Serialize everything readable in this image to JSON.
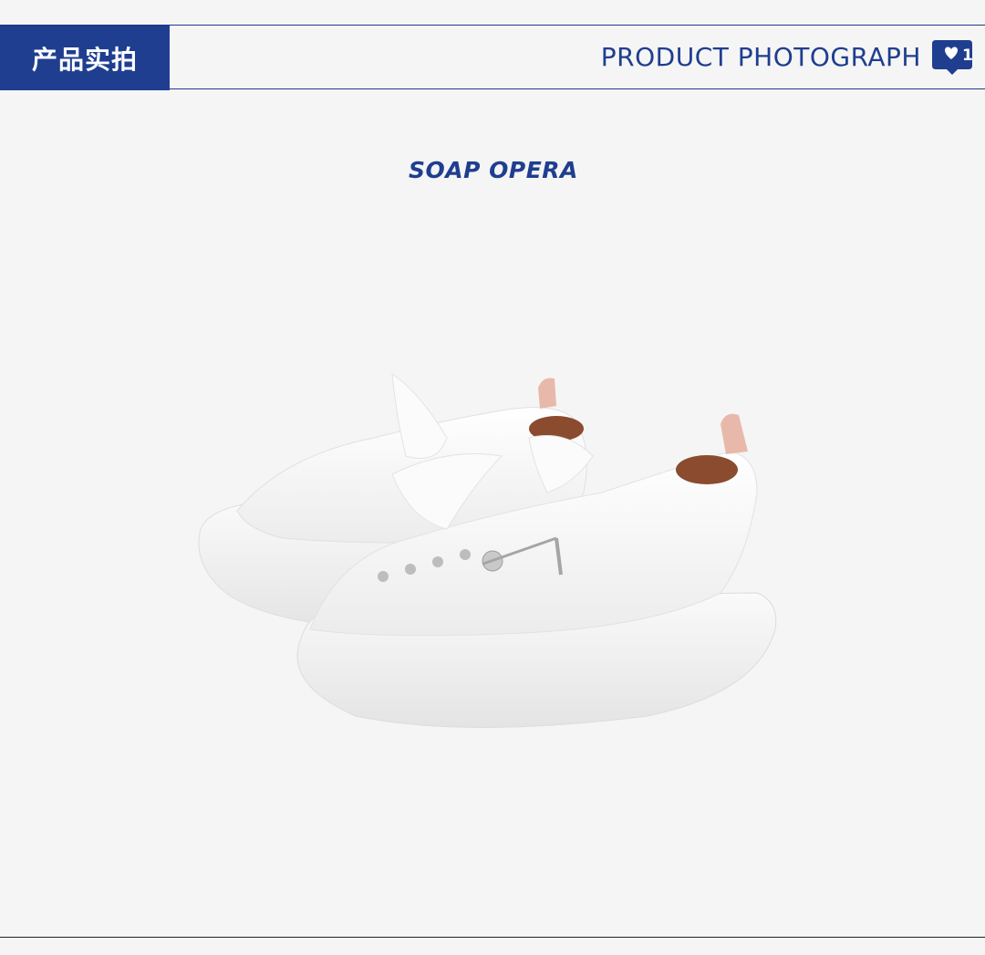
{
  "header": {
    "cn_title": "产品实拍",
    "en_title": "PRODUCT PHOTOGRAPH",
    "like_count": "1"
  },
  "brand": {
    "name": "SOAP OPERA"
  },
  "colors": {
    "brand_blue": "#1f3e8f",
    "background": "#f5f5f5",
    "sneaker_accent": "#e8b9ab"
  },
  "icons": {
    "like": "heart-chat-bubble-icon"
  },
  "image": {
    "subject": "white canvas platform sneakers with frayed edges"
  }
}
